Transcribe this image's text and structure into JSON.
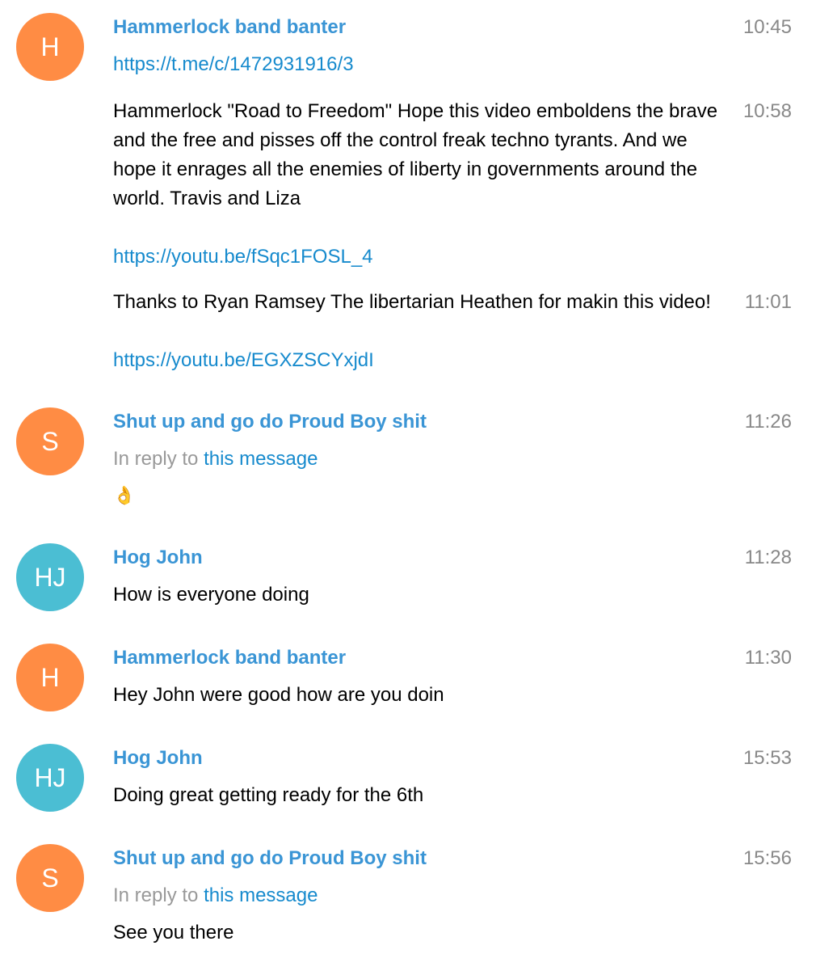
{
  "colors": {
    "avatar_orange": "#ff8c44",
    "avatar_teal": "#4bbed3",
    "author_blue": "#3a95d5",
    "link_blue": "#168acd",
    "time_gray": "#888888"
  },
  "messages": [
    {
      "avatar_initials": "H",
      "author": "Hammerlock band banter",
      "time": "10:45",
      "link": "https://t.me/c/1472931916/3"
    },
    {
      "time": "10:58",
      "text": "Hammerlock \"Road to Freedom\" Hope this video emboldens the brave and the free and pisses off the control freak techno tyrants. And we hope it enrages all the enemies of liberty in governments around the world. Travis and Liza",
      "link": "https://youtu.be/fSqc1FOSL_4"
    },
    {
      "time": "11:01",
      "text": "Thanks to Ryan Ramsey The libertarian Heathen for makin this video!",
      "link": "https://youtu.be/EGXZSCYxjdI"
    },
    {
      "avatar_initials": "S",
      "author": "Shut up and go do Proud Boy shit",
      "time": "11:26",
      "reply_prefix": "In reply to",
      "reply_link": "this message",
      "emoji": "👌"
    },
    {
      "avatar_initials": "HJ",
      "author": "Hog John",
      "time": "11:28",
      "text": "How is everyone doing"
    },
    {
      "avatar_initials": "H",
      "author": "Hammerlock band banter",
      "time": "11:30",
      "text": "Hey John were good how are you doin"
    },
    {
      "avatar_initials": "HJ",
      "author": "Hog John",
      "time": "15:53",
      "text": "Doing great getting ready for the 6th"
    },
    {
      "avatar_initials": "S",
      "author": "Shut up and go do Proud Boy shit",
      "time": "15:56",
      "reply_prefix": "In reply to",
      "reply_link": "this message",
      "text": "See you there"
    }
  ]
}
